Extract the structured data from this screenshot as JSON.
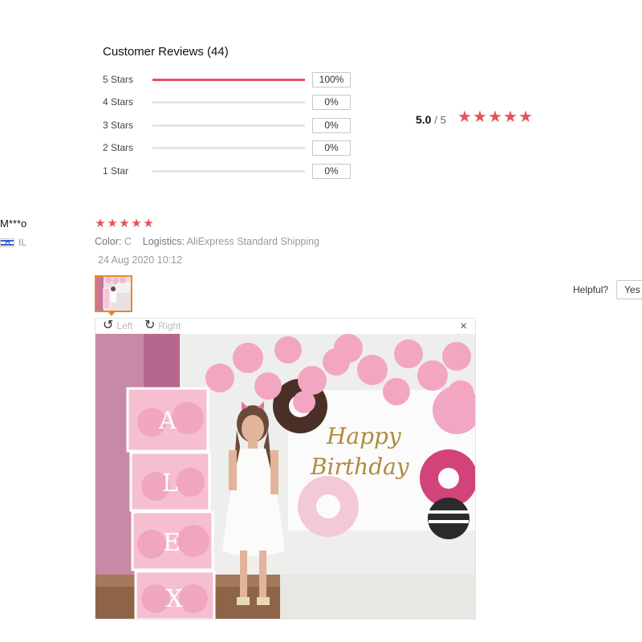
{
  "reviews": {
    "title": "Customer Reviews (44)",
    "rows": [
      {
        "label": "5 Stars",
        "percent": "100%",
        "fill": 1.0
      },
      {
        "label": "4 Stars",
        "percent": "0%",
        "fill": 0
      },
      {
        "label": "3 Stars",
        "percent": "0%",
        "fill": 0
      },
      {
        "label": "2 Stars",
        "percent": "0%",
        "fill": 0
      },
      {
        "label": "1 Star",
        "percent": "0%",
        "fill": 0
      }
    ],
    "average": "5.0",
    "out_of": "/ 5",
    "average_stars": 5
  },
  "review": {
    "username": "M***o",
    "country": "IL",
    "rating": 5,
    "color_label": "Color:",
    "color_value": "C",
    "logistics_label": "Logistics:",
    "logistics_value": "AliExpress Standard Shipping",
    "date": "24 Aug 2020 10:12",
    "helpful_label": "Helpful?",
    "yes_label": "Yes"
  },
  "viewer": {
    "rotate_left_label": "Left",
    "rotate_right_label": "Right",
    "close_icon": "×",
    "photo_text_1": "Happy",
    "photo_text_2": "Birthday",
    "box_letters": [
      "A",
      "L",
      "E",
      "X"
    ]
  },
  "colors": {
    "accent": "#e3545a",
    "thumb_border": "#e88a2a"
  }
}
